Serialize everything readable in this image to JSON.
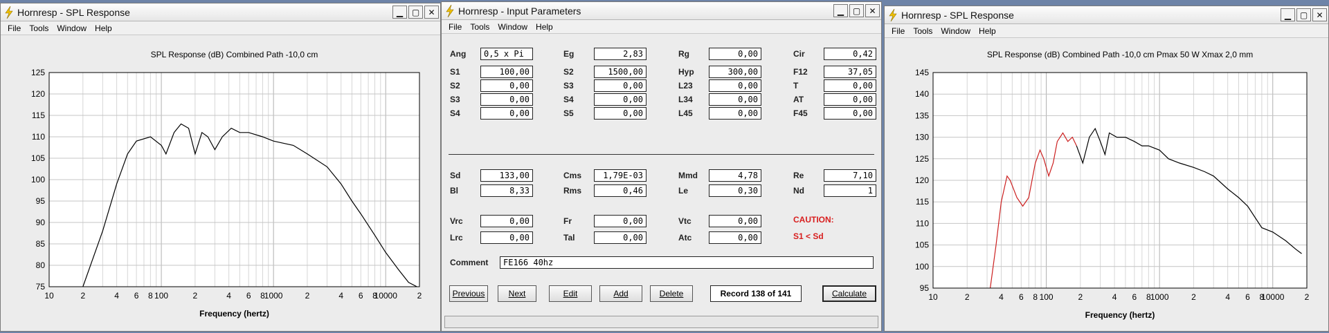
{
  "menus": [
    "File",
    "Tools",
    "Window",
    "Help"
  ],
  "icons": {
    "app": "hornresp-lightning-icon",
    "minimize": "minimize-icon",
    "maximize": "maximize-icon",
    "close": "close-icon"
  },
  "left": {
    "title": "Hornresp - SPL Response",
    "chart_data": {
      "type": "line",
      "title": "SPL Response (dB)   Combined   Path -10,0 cm",
      "xlabel": "Frequency (hertz)",
      "ylabel": "",
      "xscale": "log",
      "xlim": [
        10,
        20000
      ],
      "ylim": [
        75,
        125
      ],
      "yticks": [
        "75",
        "80",
        "85",
        "90",
        "95",
        "100",
        "105",
        "110",
        "115",
        "120",
        "125"
      ],
      "xtick_labels": [
        {
          "v": 10,
          "t": "10"
        },
        {
          "v": 20,
          "t": "2"
        },
        {
          "v": 40,
          "t": "4"
        },
        {
          "v": 60,
          "t": "6"
        },
        {
          "v": 80,
          "t": "8"
        },
        {
          "v": 100,
          "t": "100"
        },
        {
          "v": 200,
          "t": "2"
        },
        {
          "v": 400,
          "t": "4"
        },
        {
          "v": 600,
          "t": "6"
        },
        {
          "v": 800,
          "t": "8"
        },
        {
          "v": 1000,
          "t": "1000"
        },
        {
          "v": 2000,
          "t": "2"
        },
        {
          "v": 4000,
          "t": "4"
        },
        {
          "v": 6000,
          "t": "6"
        },
        {
          "v": 8000,
          "t": "8"
        },
        {
          "v": 10000,
          "t": "10000"
        },
        {
          "v": 20000,
          "t": "2"
        }
      ],
      "grid": true,
      "series": [
        {
          "color": "#000000",
          "points": [
            [
              20,
              75
            ],
            [
              30,
              88
            ],
            [
              40,
              99
            ],
            [
              50,
              106
            ],
            [
              60,
              109
            ],
            [
              80,
              110
            ],
            [
              100,
              108
            ],
            [
              110,
              106
            ],
            [
              130,
              111
            ],
            [
              150,
              113
            ],
            [
              175,
              112
            ],
            [
              200,
              106
            ],
            [
              230,
              111
            ],
            [
              260,
              110
            ],
            [
              300,
              107
            ],
            [
              350,
              110
            ],
            [
              420,
              112
            ],
            [
              500,
              111
            ],
            [
              600,
              111
            ],
            [
              800,
              110
            ],
            [
              1000,
              109
            ],
            [
              1500,
              108
            ],
            [
              2000,
              106
            ],
            [
              3000,
              103
            ],
            [
              4000,
              99
            ],
            [
              5000,
              95
            ],
            [
              6000,
              92
            ],
            [
              8000,
              87
            ],
            [
              10000,
              83
            ],
            [
              13000,
              79
            ],
            [
              16000,
              76
            ],
            [
              19000,
              75
            ]
          ]
        }
      ]
    }
  },
  "params": {
    "title": "Hornresp - Input Parameters",
    "rows1": [
      {
        "c1": {
          "label": "Ang",
          "value": "0,5 x Pi",
          "align": "left"
        },
        "c2": {
          "label": "Eg",
          "value": "2,83"
        },
        "c3": {
          "label": "Rg",
          "value": "0,00"
        },
        "c4": {
          "label": "Cir",
          "value": "0,42"
        }
      },
      {
        "c1": {
          "label": "S1",
          "value": "100,00"
        },
        "c2": {
          "label": "S2",
          "value": "1500,00"
        },
        "c3": {
          "label": "Hyp",
          "value": "300,00"
        },
        "c4": {
          "label": "F12",
          "value": "37,05"
        }
      },
      {
        "c1": {
          "label": "S2",
          "value": "0,00"
        },
        "c2": {
          "label": "S3",
          "value": "0,00"
        },
        "c3": {
          "label": "L23",
          "value": "0,00"
        },
        "c4": {
          "label": "T",
          "value": "0,00"
        }
      },
      {
        "c1": {
          "label": "S3",
          "value": "0,00"
        },
        "c2": {
          "label": "S4",
          "value": "0,00"
        },
        "c3": {
          "label": "L34",
          "value": "0,00"
        },
        "c4": {
          "label": "AT",
          "value": "0,00"
        }
      },
      {
        "c1": {
          "label": "S4",
          "value": "0,00"
        },
        "c2": {
          "label": "S5",
          "value": "0,00"
        },
        "c3": {
          "label": "L45",
          "value": "0,00"
        },
        "c4": {
          "label": "F45",
          "value": "0,00"
        }
      }
    ],
    "rows2": [
      {
        "c1": {
          "label": "Sd",
          "value": "133,00"
        },
        "c2": {
          "label": "Cms",
          "value": "1,79E-03"
        },
        "c3": {
          "label": "Mmd",
          "value": "4,78"
        },
        "c4": {
          "label": "Re",
          "value": "7,10"
        }
      },
      {
        "c1": {
          "label": "Bl",
          "value": "8,33"
        },
        "c2": {
          "label": "Rms",
          "value": "0,46"
        },
        "c3": {
          "label": "Le",
          "value": "0,30"
        },
        "c4": {
          "label": "Nd",
          "value": "1"
        }
      }
    ],
    "rows3": [
      {
        "c1": {
          "label": "Vrc",
          "value": "0,00"
        },
        "c2": {
          "label": "Fr",
          "value": "0,00"
        },
        "c3": {
          "label": "Vtc",
          "value": "0,00"
        }
      },
      {
        "c1": {
          "label": "Lrc",
          "value": "0,00"
        },
        "c2": {
          "label": "Tal",
          "value": "0,00"
        },
        "c3": {
          "label": "Atc",
          "value": "0,00"
        }
      }
    ],
    "caution": "CAUTION:",
    "caution_msg": "S1 < Sd",
    "comment_label": "Comment",
    "comment_value": "FE166 40hz",
    "buttons": {
      "previous": "Previous",
      "next": "Next",
      "edit": "Edit",
      "add": "Add",
      "delete": "Delete",
      "calculate": "Calculate"
    },
    "record": "Record 138 of 141"
  },
  "right": {
    "title": "Hornresp - SPL Response",
    "chart_data": {
      "type": "line",
      "title": "SPL Response (dB)   Combined   Path -10,0 cm   Pmax 50 W   Xmax 2,0 mm",
      "xlabel": "Frequency (hertz)",
      "ylabel": "",
      "xscale": "log",
      "xlim": [
        10,
        20000
      ],
      "ylim": [
        95,
        145
      ],
      "yticks": [
        "95",
        "100",
        "105",
        "110",
        "115",
        "120",
        "125",
        "130",
        "135",
        "140",
        "145"
      ],
      "xtick_labels": [
        {
          "v": 10,
          "t": "10"
        },
        {
          "v": 20,
          "t": "2"
        },
        {
          "v": 40,
          "t": "4"
        },
        {
          "v": 60,
          "t": "6"
        },
        {
          "v": 80,
          "t": "8"
        },
        {
          "v": 100,
          "t": "100"
        },
        {
          "v": 200,
          "t": "2"
        },
        {
          "v": 400,
          "t": "4"
        },
        {
          "v": 600,
          "t": "6"
        },
        {
          "v": 800,
          "t": "8"
        },
        {
          "v": 1000,
          "t": "1000"
        },
        {
          "v": 2000,
          "t": "2"
        },
        {
          "v": 4000,
          "t": "4"
        },
        {
          "v": 6000,
          "t": "6"
        },
        {
          "v": 8000,
          "t": "8"
        },
        {
          "v": 10000,
          "t": "10000"
        },
        {
          "v": 20000,
          "t": "2"
        }
      ],
      "grid": true,
      "series": [
        {
          "color": "#cc1f1f",
          "points": [
            [
              32,
              95
            ],
            [
              36,
              105
            ],
            [
              40,
              115
            ],
            [
              45,
              121
            ],
            [
              48,
              120
            ],
            [
              55,
              116
            ],
            [
              62,
              114
            ],
            [
              70,
              116
            ],
            [
              80,
              124
            ],
            [
              88,
              127
            ],
            [
              95,
              125
            ],
            [
              105,
              121
            ],
            [
              115,
              124
            ],
            [
              125,
              129
            ],
            [
              140,
              131
            ],
            [
              155,
              129
            ],
            [
              170,
              130
            ],
            [
              185,
              128
            ]
          ]
        },
        {
          "color": "#000000",
          "points": [
            [
              185,
              128
            ],
            [
              210,
              124
            ],
            [
              240,
              130
            ],
            [
              270,
              132
            ],
            [
              300,
              129
            ],
            [
              330,
              126
            ],
            [
              360,
              131
            ],
            [
              420,
              130
            ],
            [
              500,
              130
            ],
            [
              600,
              129
            ],
            [
              700,
              128
            ],
            [
              800,
              128
            ],
            [
              1000,
              127
            ],
            [
              1200,
              125
            ],
            [
              1500,
              124
            ],
            [
              2000,
              123
            ],
            [
              2500,
              122
            ],
            [
              3000,
              121
            ],
            [
              4000,
              118
            ],
            [
              5000,
              116
            ],
            [
              6000,
              114
            ],
            [
              8000,
              109
            ],
            [
              10000,
              108
            ],
            [
              13000,
              106
            ],
            [
              16000,
              104
            ],
            [
              18000,
              103
            ]
          ]
        }
      ]
    }
  }
}
